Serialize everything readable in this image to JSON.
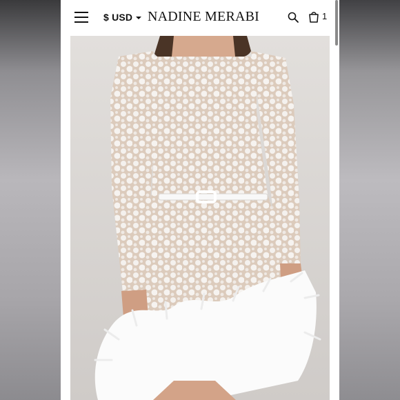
{
  "header": {
    "currency_label": "$ USD",
    "brand_name": "NADINE MERABI",
    "cart_count": "1"
  },
  "icons": [
    "menu-icon",
    "caret-down-icon",
    "search-icon",
    "shopping-bag-icon"
  ],
  "product": {
    "image_subject": "white lace long-sleeve mini dress with belt and feather hem",
    "colors": {
      "lace": "#f4f1ee",
      "lining": "#dccbbc",
      "feathers": "#fbfbfb",
      "background": "#d9d6d3"
    }
  }
}
